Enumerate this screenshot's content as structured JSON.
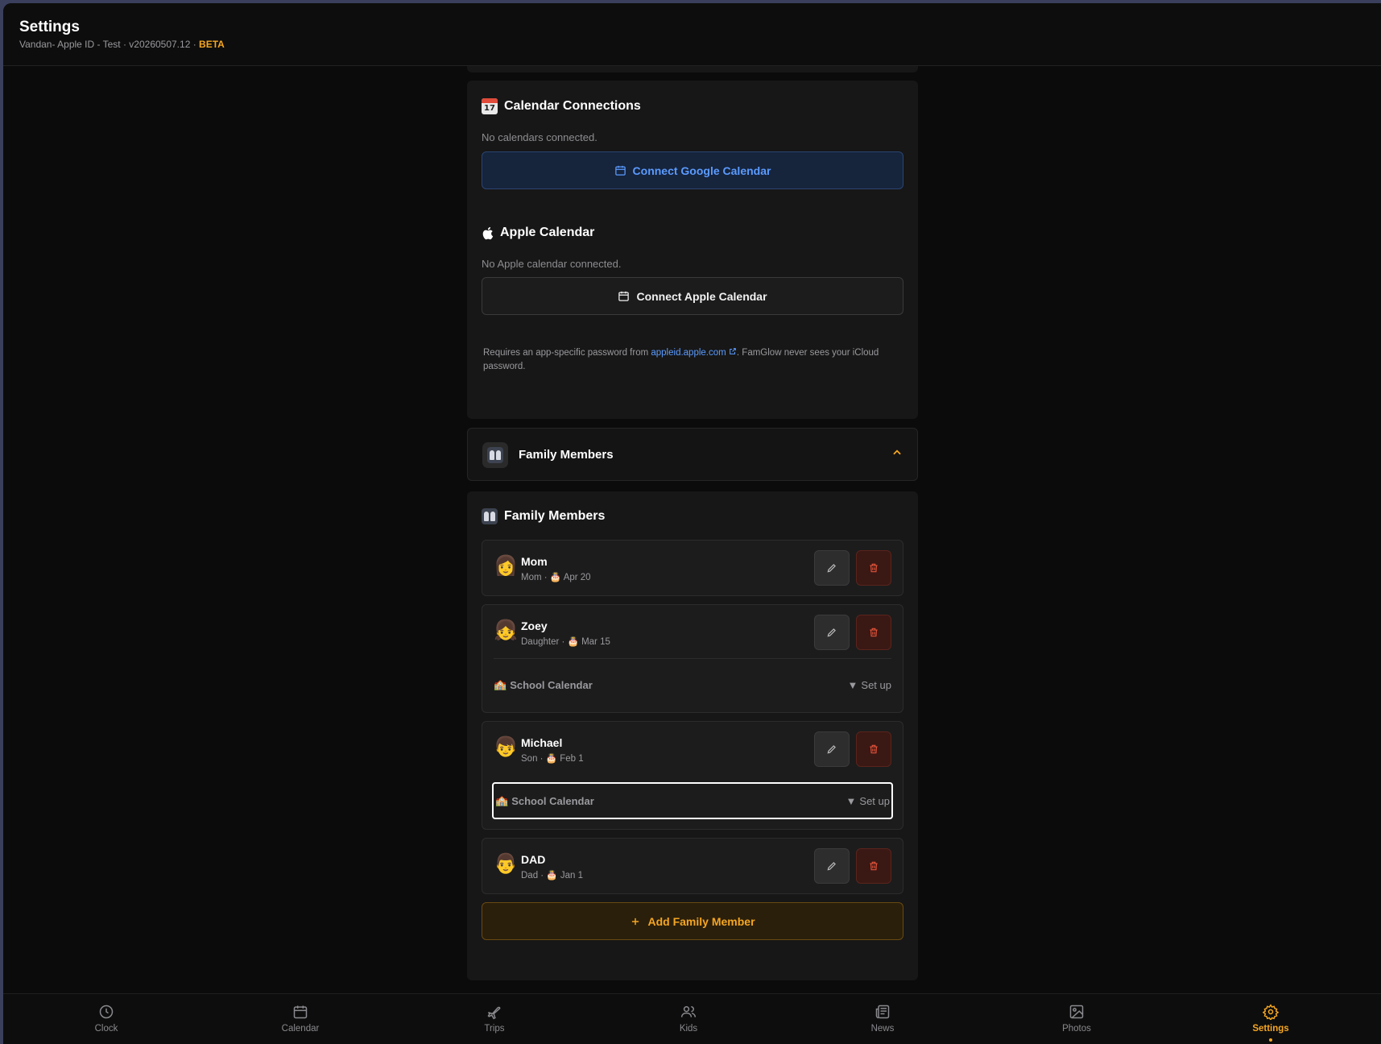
{
  "header": {
    "title": "Settings",
    "subtitle": "Vandan- Apple ID - Test · v20260507.12 · ",
    "badge": "BETA"
  },
  "calendar_section": {
    "title": "Calendar Connections",
    "empty_text": "No calendars connected.",
    "google_button": "Connect Google Calendar",
    "apple_title": "Apple Calendar",
    "apple_empty_text": "No Apple calendar connected.",
    "apple_button": "Connect Apple Calendar",
    "note_prefix": "Requires an app-specific password from ",
    "note_link": "appleid.apple.com",
    "note_suffix": ". FamGlow never sees your iCloud password."
  },
  "family_collapse": {
    "label": "Family Members",
    "expanded": true
  },
  "family_section": {
    "title": "Family Members",
    "members": [
      {
        "name": "Mom",
        "relation": "Mom",
        "birthday": "Apr 20",
        "avatar": "👩"
      },
      {
        "name": "Zoey",
        "relation": "Daughter",
        "birthday": "Mar 15",
        "avatar": "👧"
      },
      {
        "name": "Michael",
        "relation": "Son",
        "birthday": "Feb 1",
        "avatar": "👦"
      },
      {
        "name": "DAD",
        "relation": "Dad",
        "birthday": "Jan 1",
        "avatar": "👨"
      }
    ],
    "school_label": "School Calendar",
    "school_action": "Set up",
    "add_button": "Add Family Member"
  },
  "tabs": [
    {
      "label": "Clock",
      "icon": "clock-icon"
    },
    {
      "label": "Calendar",
      "icon": "calendar-icon"
    },
    {
      "label": "Trips",
      "icon": "plane-icon"
    },
    {
      "label": "Kids",
      "icon": "users-icon"
    },
    {
      "label": "News",
      "icon": "newspaper-icon"
    },
    {
      "label": "Photos",
      "icon": "image-icon"
    },
    {
      "label": "Settings",
      "icon": "gear-icon",
      "active": true
    }
  ],
  "colors": {
    "accent": "#f5a623",
    "link": "#5b9bff",
    "danger": "#e0533a"
  }
}
